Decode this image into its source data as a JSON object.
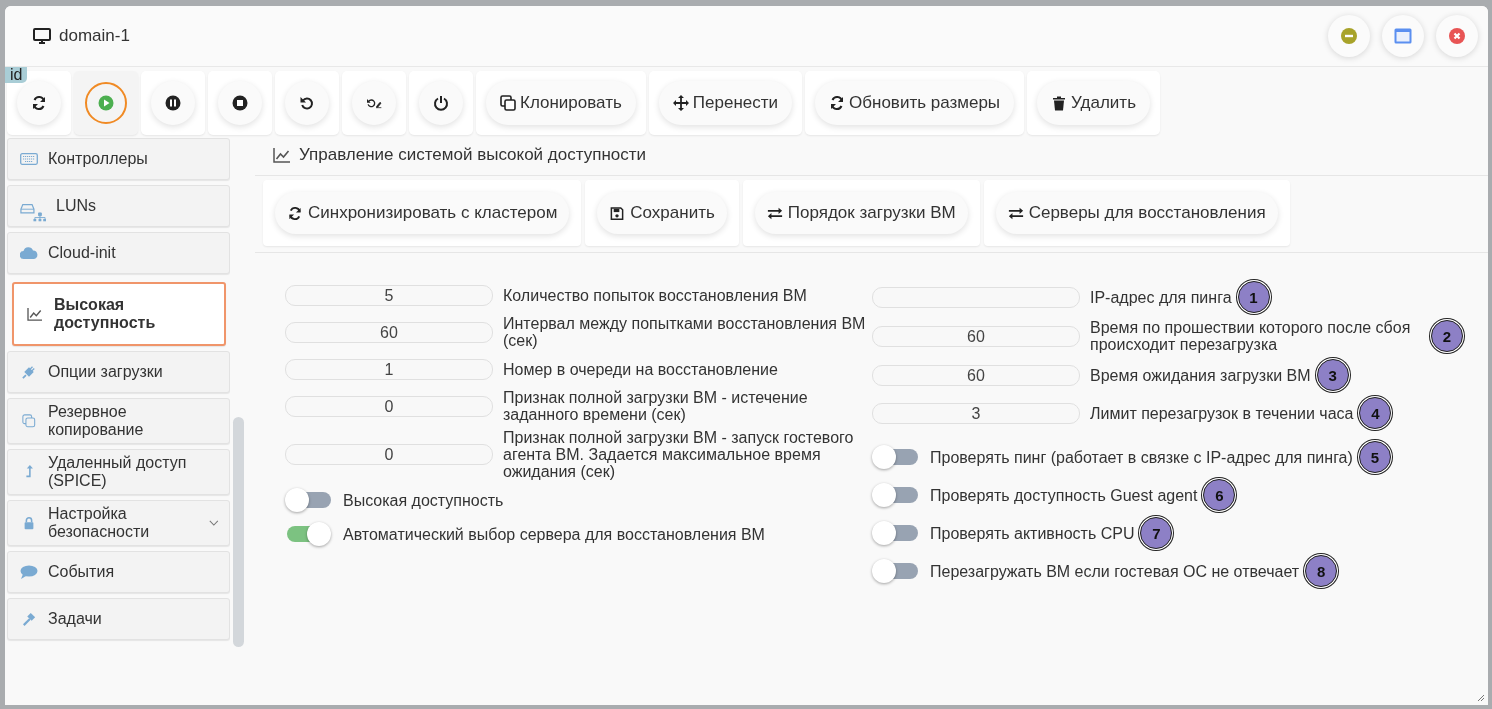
{
  "window": {
    "title": "domain-1"
  },
  "id_tag": "id",
  "toolbar": [
    {
      "selected": false
    },
    {
      "selected": true
    },
    {
      "selected": false
    },
    {
      "selected": false
    },
    {
      "selected": false
    },
    {
      "selected": false
    },
    {
      "selected": false
    },
    {
      "label": "Клонировать",
      "selected": false
    },
    {
      "label": "Перенести",
      "selected": false
    },
    {
      "label": "Обновить размеры",
      "selected": false
    },
    {
      "label": "Удалить",
      "selected": false
    }
  ],
  "sidebar": {
    "items": [
      {
        "label": "Контроллеры",
        "selected": false,
        "kind": "link"
      },
      {
        "label": "LUNs",
        "selected": false,
        "kind": "link"
      },
      {
        "label": "Cloud-init",
        "selected": false,
        "kind": "link"
      },
      {
        "label": "Высокая доступность",
        "selected": true,
        "kind": "link"
      },
      {
        "label": "Опции загрузки",
        "selected": false,
        "kind": "link"
      },
      {
        "label": "Резервное копирование",
        "selected": false,
        "kind": "link"
      },
      {
        "label": "Удаленный доступ (SPICE)",
        "selected": false,
        "kind": "link"
      },
      {
        "label": "Настройка безопасности",
        "selected": false,
        "kind": "group"
      },
      {
        "label": "События",
        "selected": false,
        "kind": "link"
      },
      {
        "label": "Задачи",
        "selected": false,
        "kind": "link"
      }
    ]
  },
  "section": {
    "title": "Управление системой высокой доступности",
    "actions": [
      "Синхронизировать с кластером",
      "Сохранить",
      "Порядок загрузки ВМ",
      "Серверы для восстановления"
    ]
  },
  "left_fields": [
    {
      "kind": "number",
      "value": "5",
      "label": "Количество попыток восстановления ВМ"
    },
    {
      "kind": "number",
      "value": "60",
      "label": "Интервал между попытками восстановления ВМ (сек)"
    },
    {
      "kind": "number",
      "value": "1",
      "label": "Номер в очереди на восстановление"
    },
    {
      "kind": "number",
      "value": "0",
      "label": "Признак полной загрузки ВМ - истечение заданного времени (сек)"
    },
    {
      "kind": "number",
      "value": "0",
      "label": "Признак полной загрузки ВМ - запуск гостевого агента ВМ. Задается максимальное время ожидания (сек)"
    },
    {
      "kind": "toggle",
      "on": false,
      "label": "Высокая доступность"
    },
    {
      "kind": "toggle",
      "on": true,
      "label": "Автоматический выбор сервера для восстановления ВМ"
    }
  ],
  "right_fields": [
    {
      "kind": "number",
      "label": "IP-адрес для пинга",
      "badge": "1"
    },
    {
      "kind": "number",
      "value": "60",
      "label": "Время по прошествии которого после сбоя происходит перезагрузка",
      "badge": "2"
    },
    {
      "kind": "number",
      "value": "60",
      "label": "Время ожидания загрузки ВМ",
      "badge": "3"
    },
    {
      "kind": "number",
      "value": "3",
      "label": "Лимит перезагрузок в течении часа",
      "badge": "4"
    },
    {
      "kind": "toggle",
      "on": false,
      "label": "Проверять пинг (работает в связке с IP-адрес для пинга)",
      "badge": "5"
    },
    {
      "kind": "toggle",
      "on": false,
      "label": "Проверять доступность Guest agent",
      "badge": "6"
    },
    {
      "kind": "toggle",
      "on": false,
      "label": "Проверять активность CPU",
      "badge": "7"
    },
    {
      "kind": "toggle",
      "on": false,
      "label": "Перезагружать ВМ если гостевая ОС не отвечает",
      "badge": "8"
    }
  ]
}
